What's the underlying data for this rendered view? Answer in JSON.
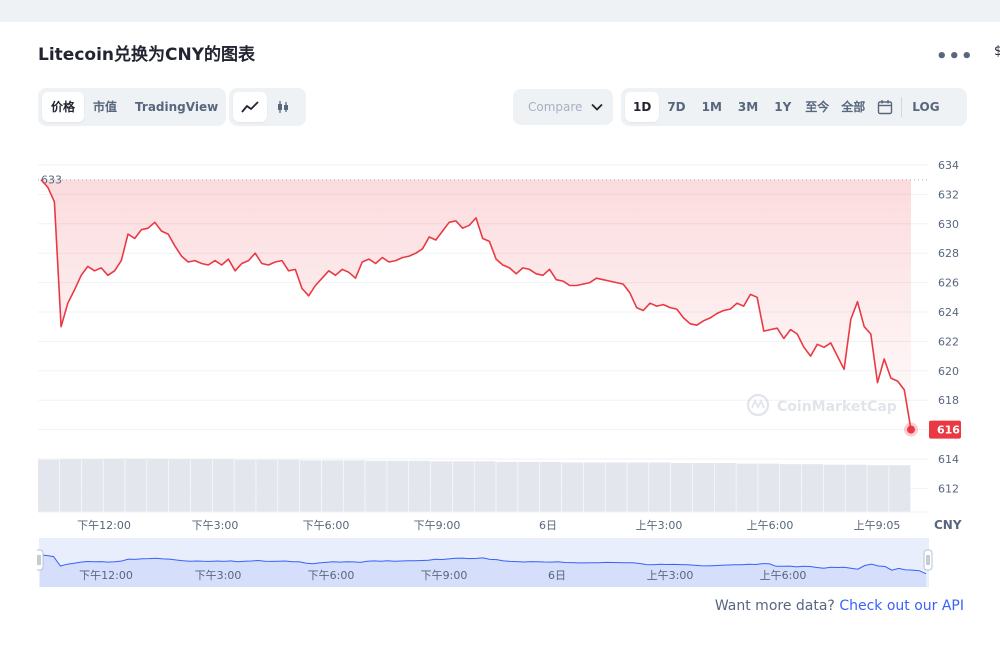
{
  "header": {
    "title": "Litecoin兑换为CNY的图表",
    "more_icon": "more-horizontal-icon",
    "edge_glyph": "$"
  },
  "toolbar": {
    "type_tabs": [
      {
        "label": "价格",
        "active": true
      },
      {
        "label": "市值",
        "active": false
      },
      {
        "label": "TradingView",
        "active": false
      }
    ],
    "chart_style_icons": [
      "line-chart-icon",
      "candlestick-icon"
    ],
    "compare_label": "Compare",
    "compare_icon": "chevron-down-icon",
    "ranges": [
      {
        "label": "1D",
        "active": true
      },
      {
        "label": "7D",
        "active": false
      },
      {
        "label": "1M",
        "active": false
      },
      {
        "label": "3M",
        "active": false
      },
      {
        "label": "1Y",
        "active": false
      },
      {
        "label": "至今",
        "active": false
      },
      {
        "label": "全部",
        "active": false
      }
    ],
    "calendar_icon": "calendar-icon",
    "log_label": "LOG"
  },
  "chart_data": {
    "type": "area",
    "title": "",
    "currency_label": "CNY",
    "watermark": "CoinMarketCap",
    "y_ticks": [
      612,
      614,
      616,
      618,
      620,
      622,
      624,
      626,
      628,
      630,
      632,
      634
    ],
    "ylim": [
      611,
      635
    ],
    "x_ticks": [
      "下午12:00",
      "下午3:00",
      "下午6:00",
      "下午9:00",
      "6日",
      "上午3:00",
      "上午6:00",
      "上午9:05"
    ],
    "open_value": 633,
    "current_value": 616,
    "series": [
      {
        "name": "",
        "color": "#ea3943",
        "values": [
          633.0,
          632.5,
          631.5,
          623.0,
          624.6,
          625.5,
          626.5,
          627.1,
          626.8,
          627.0,
          626.5,
          626.8,
          627.5,
          629.3,
          629.0,
          629.6,
          629.7,
          630.1,
          629.5,
          629.3,
          628.5,
          627.8,
          627.4,
          627.5,
          627.3,
          627.2,
          627.5,
          627.2,
          627.6,
          626.8,
          627.3,
          627.5,
          628.0,
          627.3,
          627.2,
          627.4,
          627.5,
          626.8,
          626.9,
          625.6,
          625.1,
          625.8,
          626.3,
          626.8,
          626.5,
          626.9,
          626.7,
          626.3,
          627.4,
          627.6,
          627.3,
          627.7,
          627.4,
          627.5,
          627.7,
          627.8,
          628.0,
          628.3,
          629.1,
          628.9,
          629.5,
          630.1,
          630.2,
          629.7,
          629.9,
          630.4,
          629.0,
          628.8,
          627.6,
          627.2,
          627.0,
          626.6,
          627.0,
          626.9,
          626.6,
          626.5,
          626.9,
          626.2,
          626.1,
          625.8,
          625.8,
          625.9,
          626.0,
          626.3,
          626.2,
          626.1,
          626.0,
          625.9,
          625.3,
          624.3,
          624.1,
          624.6,
          624.4,
          624.5,
          624.3,
          624.2,
          623.6,
          623.2,
          623.1,
          623.4,
          623.6,
          623.9,
          624.1,
          624.2,
          624.6,
          624.4,
          625.2,
          625.0,
          622.7,
          622.8,
          622.9,
          622.2,
          622.8,
          622.5,
          621.6,
          621.0,
          621.8,
          621.6,
          621.9,
          621.0,
          620.1,
          623.5,
          624.7,
          623.0,
          622.5,
          619.2,
          620.8,
          619.5,
          619.3,
          618.7,
          616.0
        ]
      }
    ],
    "volume_ticks_note": "",
    "volume_values": [
      0.95,
      0.96,
      0.96,
      0.97,
      0.97,
      0.97,
      0.96,
      0.96,
      0.96,
      0.95,
      0.95,
      0.95,
      0.94,
      0.94,
      0.94,
      0.93,
      0.93,
      0.93,
      0.92,
      0.92,
      0.92,
      0.91,
      0.91,
      0.91,
      0.9,
      0.9,
      0.9,
      0.9,
      0.9,
      0.89,
      0.89,
      0.89,
      0.88,
      0.88,
      0.87,
      0.87,
      0.86,
      0.86,
      0.85,
      0.85
    ]
  },
  "navigator": {
    "x_ticks": [
      "下午12:00",
      "下午3:00",
      "下午6:00",
      "下午9:00",
      "6日",
      "上午3:00",
      "上午6:00"
    ],
    "handle_left_icon": "drag-handle-icon",
    "handle_right_icon": "drag-handle-icon"
  },
  "footer": {
    "prefix": "Want more data? ",
    "link": "Check out our API"
  }
}
